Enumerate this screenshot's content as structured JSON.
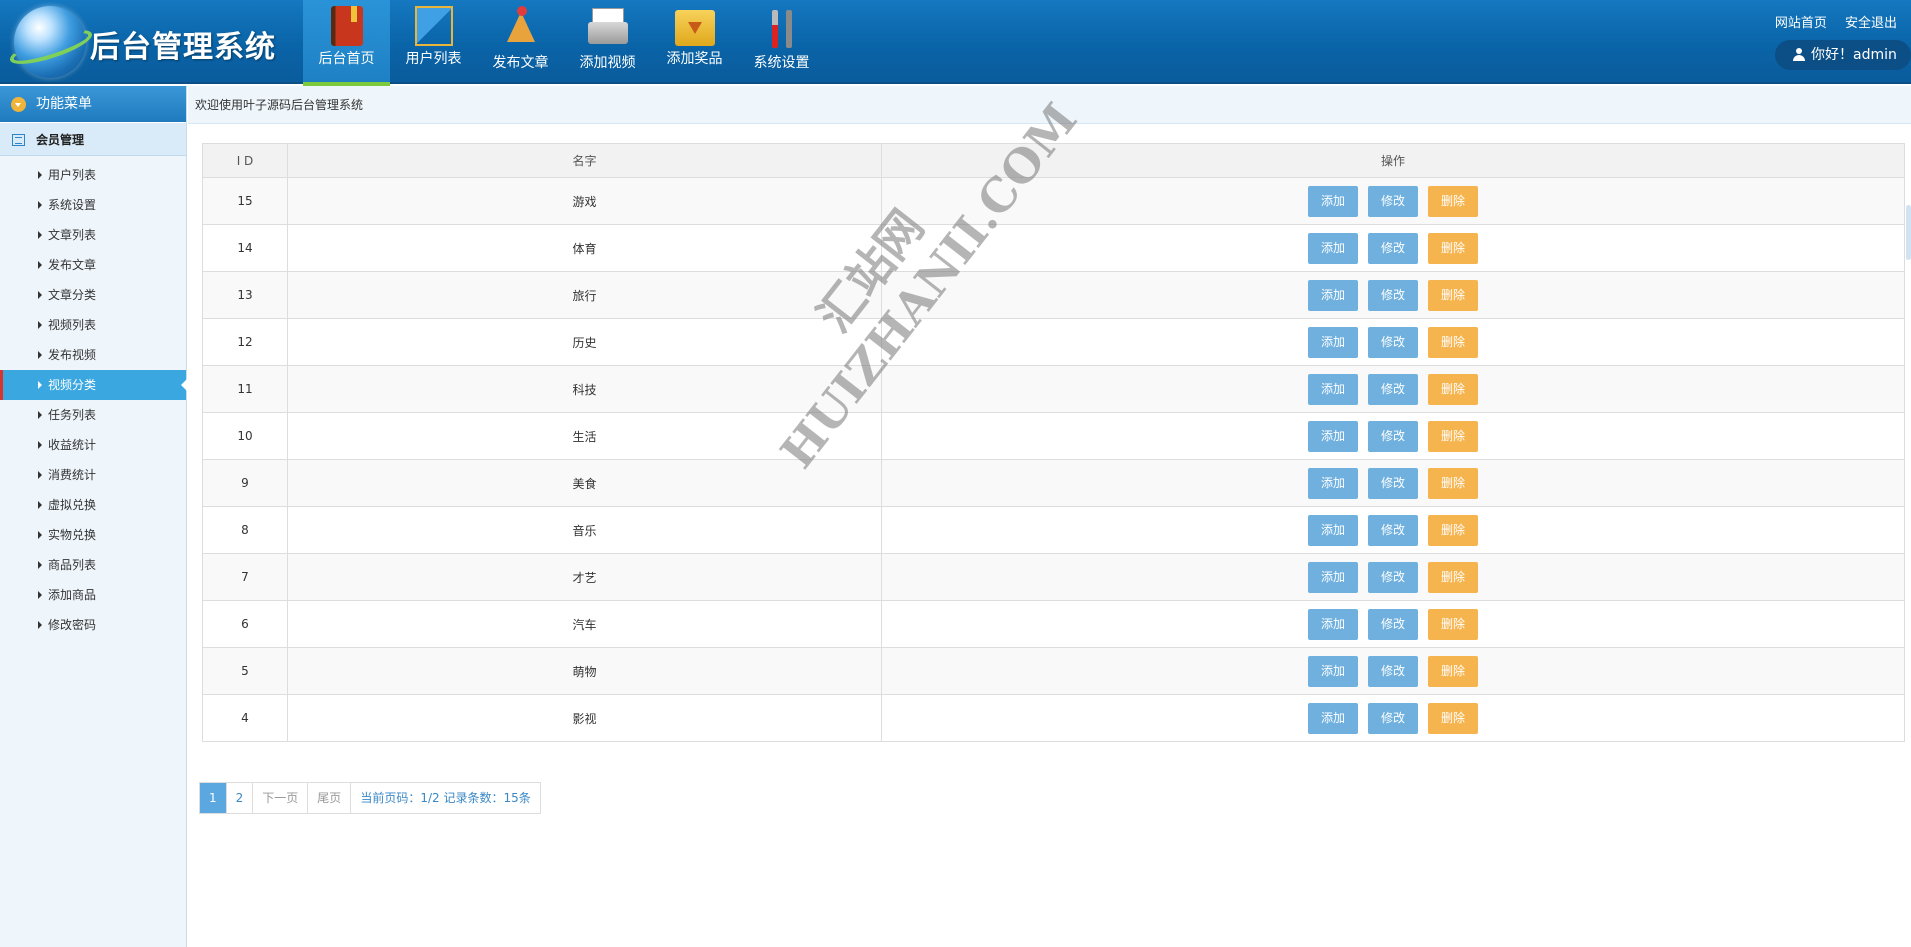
{
  "app": {
    "title": "后台管理系统"
  },
  "topnav": [
    {
      "label": "后台首页",
      "icon": "book-icon",
      "active": true
    },
    {
      "label": "用户列表",
      "icon": "ruler-icon"
    },
    {
      "label": "发布文章",
      "icon": "star-tools-icon"
    },
    {
      "label": "添加视频",
      "icon": "printer-icon"
    },
    {
      "label": "添加奖品",
      "icon": "download-folder-icon"
    },
    {
      "label": "系统设置",
      "icon": "tools-icon"
    }
  ],
  "header_links": {
    "site_home": "网站首页",
    "logout": "安全退出"
  },
  "user": {
    "greeting": "你好！admin"
  },
  "sidebar": {
    "title": "功能菜单",
    "group": "会员管理",
    "items": [
      {
        "label": "用户列表"
      },
      {
        "label": "系统设置"
      },
      {
        "label": "文章列表"
      },
      {
        "label": "发布文章"
      },
      {
        "label": "文章分类"
      },
      {
        "label": "视频列表"
      },
      {
        "label": "发布视频"
      },
      {
        "label": "视频分类",
        "active": true
      },
      {
        "label": "任务列表"
      },
      {
        "label": "收益统计"
      },
      {
        "label": "消费统计"
      },
      {
        "label": "虚拟兑换"
      },
      {
        "label": "实物兑换"
      },
      {
        "label": "商品列表"
      },
      {
        "label": "添加商品"
      },
      {
        "label": "修改密码"
      }
    ]
  },
  "breadcrumb": "欢迎使用叶子源码后台管理系统",
  "table": {
    "headers": {
      "id": "I D",
      "name": "名字",
      "actions": "操作"
    },
    "buttons": {
      "add": "添加",
      "edit": "修改",
      "delete": "删除"
    },
    "rows": [
      {
        "id": "15",
        "name": "游戏"
      },
      {
        "id": "14",
        "name": "体育"
      },
      {
        "id": "13",
        "name": "旅行"
      },
      {
        "id": "12",
        "name": "历史"
      },
      {
        "id": "11",
        "name": "科技"
      },
      {
        "id": "10",
        "name": "生活"
      },
      {
        "id": "9",
        "name": "美食"
      },
      {
        "id": "8",
        "name": "音乐"
      },
      {
        "id": "7",
        "name": "才艺"
      },
      {
        "id": "6",
        "name": "汽车"
      },
      {
        "id": "5",
        "name": "萌物"
      },
      {
        "id": "4",
        "name": "影视"
      }
    ]
  },
  "pagination": {
    "pages": [
      "1",
      "2"
    ],
    "current": "1",
    "next": "下一页",
    "last": "尾页",
    "info": "当前页码：1/2 记录条数：15条"
  },
  "watermark": {
    "text": "HUIZHANII.COM",
    "text_cn": "汇站网"
  },
  "colors": {
    "header": "#0a64a8",
    "accent": "#3aa7e0",
    "btn_blue": "#6fb0df",
    "btn_orange": "#f6b44e",
    "active_marker": "#7cc93e"
  }
}
